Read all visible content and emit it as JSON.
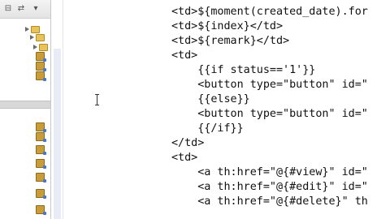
{
  "explorer": {
    "rows": [
      {
        "label": "",
        "icon": "folder-icon",
        "open": false
      },
      {
        "label": "",
        "icon": "folder-icon",
        "open": false
      },
      {
        "label": "",
        "icon": "folder-icon",
        "open": false
      },
      {
        "label": "",
        "icon": "package-icon",
        "open": false
      },
      {
        "label": "",
        "icon": "package-icon",
        "open": false
      },
      {
        "label": "",
        "icon": "package-icon",
        "open": false
      }
    ],
    "rows_lower": [
      {
        "label": "",
        "icon": "package-icon",
        "open": false
      },
      {
        "label": "",
        "icon": "package-icon",
        "open": false
      },
      {
        "label": "",
        "icon": "package-icon",
        "open": false
      },
      {
        "label": "",
        "icon": "package-icon",
        "open": false
      },
      {
        "label": "",
        "icon": "package-icon",
        "open": false
      },
      {
        "label": "",
        "icon": "package-icon",
        "open": false
      },
      {
        "label": "",
        "icon": "package-icon",
        "open": false
      }
    ]
  },
  "editor": {
    "lines": [
      "<td>${moment(created_date).for",
      "<td>${index}</td>",
      "<td>${remark}</td>",
      "<td>",
      "    {{if status=='1'}}",
      "    <button type=\"button\" id=\"",
      "    {{else}}",
      "    <button type=\"button\" id=\"",
      "    {{/if}}",
      "</td>",
      "<td>",
      "    <a th:href=\"@{#view}\" id=\"",
      "    <a th:href=\"@{#edit}\" id=\"",
      "    <a th:href=\"@{#delete}\" th"
    ],
    "cursor_icon": "text-cursor-icon"
  }
}
